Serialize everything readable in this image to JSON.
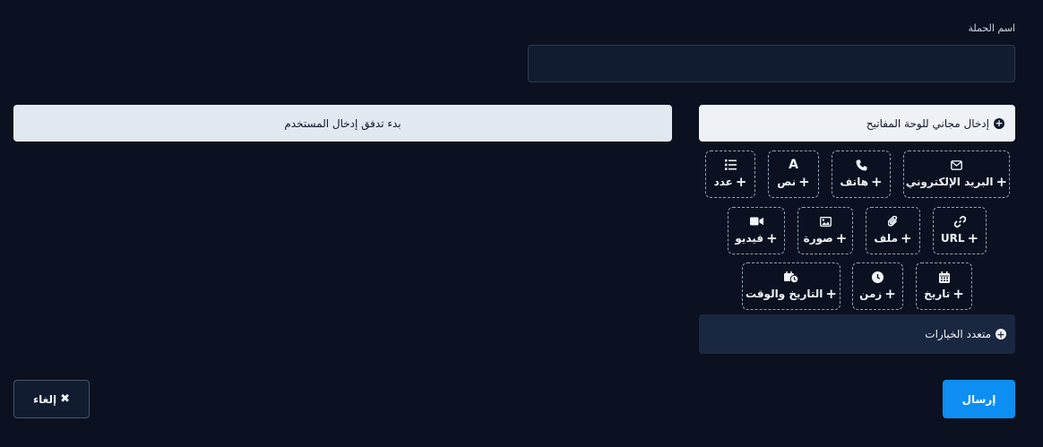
{
  "form": {
    "campaign_name_label": "اسم الحملة",
    "campaign_name_value": "",
    "free_keyboard_input": "إدخال مجاني للوحة المفاتيح",
    "start_user_input_flow": "بدء تدفق إدخال المستخدم"
  },
  "field_types": {
    "email": {
      "label": "البريد الإلكتروني",
      "icon": "envelope-icon"
    },
    "phone": {
      "label": "هاتف",
      "icon": "phone-icon"
    },
    "text": {
      "label": "نص",
      "icon": "letter-a-icon"
    },
    "number": {
      "label": "عدد",
      "icon": "list-ol-icon"
    },
    "url": {
      "label": "URL",
      "icon": "link-icon"
    },
    "file": {
      "label": "ملف",
      "icon": "paperclip-icon"
    },
    "image": {
      "label": "صورة",
      "icon": "image-icon"
    },
    "video": {
      "label": "فيديو",
      "icon": "video-icon"
    },
    "date": {
      "label": "تاريخ",
      "icon": "calendar-icon"
    },
    "time": {
      "label": "زمن",
      "icon": "clock-icon"
    },
    "datetime": {
      "label": "التاريخ والوقت",
      "icon": "calendar-clock-icon"
    }
  },
  "multiple_choice": "متعدد الخيارات",
  "actions": {
    "send": "إرسال",
    "cancel": "إلغاء"
  },
  "colors": {
    "background": "#0b1120",
    "send_button": "#0d8ef2",
    "light_button": "#e2e8f0",
    "panel": "#1a2740"
  }
}
